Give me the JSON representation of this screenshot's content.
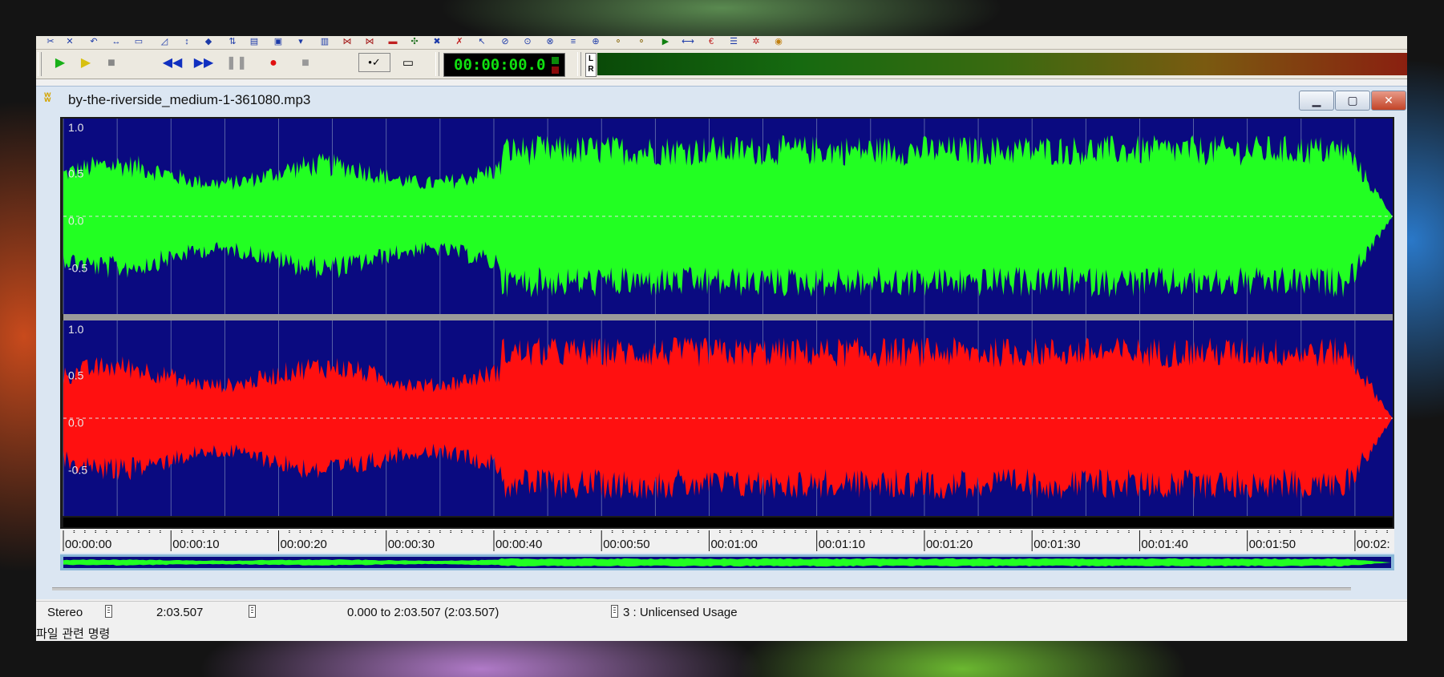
{
  "toolbar2": {
    "timecode": "00:00:00.0",
    "meter_l": "L",
    "meter_r": "R"
  },
  "document": {
    "title": "by-the-riverside_medium-1-361080.mp3"
  },
  "waveform": {
    "channels": [
      {
        "name": "left",
        "color": "#22ff22",
        "axis_labels": [
          "1.0",
          "0.5",
          "0.0",
          "-0.5"
        ]
      },
      {
        "name": "right",
        "color": "#ff1010",
        "axis_labels": [
          "1.0",
          "0.5",
          "0.0",
          "-0.5"
        ]
      }
    ],
    "background_color": "#0a0a80",
    "time_ticks": [
      "00:00:00",
      "00:00:10",
      "00:00:20",
      "00:00:30",
      "00:00:40",
      "00:00:50",
      "00:01:00",
      "00:01:10",
      "00:01:20",
      "00:01:30",
      "00:01:40",
      "00:01:50",
      "00:02:"
    ],
    "duration_seconds": 123.507
  },
  "statusbar": {
    "channels": "Stereo",
    "length": "2:03.507",
    "selection": "0.000 to 2:03.507 (2:03.507)",
    "license": "3 : Unlicensed Usage"
  },
  "hint": "파일 관련 명령",
  "icons": {
    "play": "play-icon",
    "play_selection": "play-selection-icon",
    "stop": "stop-icon",
    "rewind": "rewind-icon",
    "fast_forward": "fast-forward-icon",
    "pause": "pause-icon",
    "record": "record-icon",
    "stop_record": "stop-record-icon",
    "loop": "loop-check-icon",
    "window": "window-icon"
  }
}
